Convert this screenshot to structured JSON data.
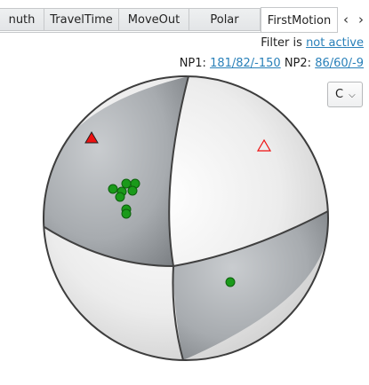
{
  "tabs": [
    {
      "label": "nuth",
      "active": false
    },
    {
      "label": "TravelTime",
      "active": false
    },
    {
      "label": "MoveOut",
      "active": false
    },
    {
      "label": "Polar",
      "active": false
    },
    {
      "label": "FirstMotion",
      "active": true
    }
  ],
  "tab_scroll_left": "‹",
  "tab_scroll_right": "›",
  "filter": {
    "label": "Filter is",
    "value": "not active"
  },
  "nodal_planes": {
    "np1_label": "NP1:",
    "np1_value": "181/82/-150",
    "np2_label": "NP2:",
    "np2_value": "86/60/-9"
  },
  "combo": {
    "value": "C"
  },
  "colors": {
    "compression_quadrant": "#b9bcbf",
    "dilatation_quadrant": "#f0f0f0",
    "polarity_up_marker": "#1a9a1a",
    "p_axis_marker": "#ee1111",
    "t_axis_marker": "#ee1111",
    "link": "#2980b9"
  }
}
